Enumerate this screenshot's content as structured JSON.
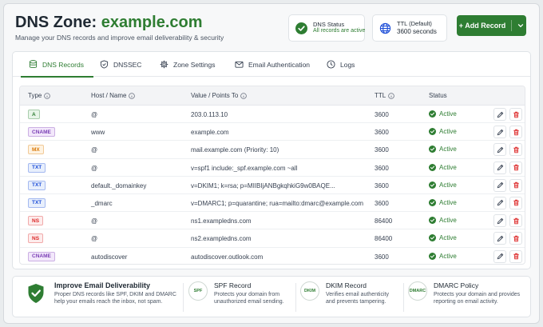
{
  "header": {
    "title_prefix": "DNS Zone: ",
    "title_domain": "example.com",
    "subtitle": "Manage your DNS records and improve email deliverability & security",
    "dns_status": {
      "title": "DNS Status",
      "value": "All records are active"
    },
    "ttl_default": {
      "title": "TTL (Default)",
      "value": "3600 seconds"
    },
    "add_record_label": "+ Add Record"
  },
  "tabs": [
    {
      "label": "DNS Records",
      "icon": "database-icon",
      "active": true
    },
    {
      "label": "DNSSEC",
      "icon": "shield-icon",
      "active": false
    },
    {
      "label": "Zone Settings",
      "icon": "gear-icon",
      "active": false
    },
    {
      "label": "Email Authentication",
      "icon": "envelope-icon",
      "active": false
    },
    {
      "label": "Logs",
      "icon": "clock-icon",
      "active": false
    }
  ],
  "table": {
    "columns": [
      "Type",
      "Host / Name",
      "Value / Points To",
      "TTL",
      "Status"
    ],
    "rows": [
      {
        "type": "A",
        "host": "@",
        "value": "203.0.113.10",
        "ttl": "3600",
        "status": "Active"
      },
      {
        "type": "CNAME",
        "host": "www",
        "value": "example.com",
        "ttl": "3600",
        "status": "Active"
      },
      {
        "type": "MX",
        "host": "@",
        "value": "mail.example.com (Priority: 10)",
        "ttl": "3600",
        "status": "Active"
      },
      {
        "type": "TXT",
        "host": "@",
        "value": "v=spf1 include:_spf.example.com ~all",
        "ttl": "3600",
        "status": "Active"
      },
      {
        "type": "TXT",
        "host": "default._domainkey",
        "value": "v=DKIM1; k=rsa; p=MIIBIjANBgkqhkiG9w0BAQE...",
        "ttl": "3600",
        "status": "Active"
      },
      {
        "type": "TXT",
        "host": "_dmarc",
        "value": "v=DMARC1; p=quarantine; rua=mailto:dmarc@example.com",
        "ttl": "3600",
        "status": "Active"
      },
      {
        "type": "NS",
        "host": "@",
        "value": "ns1.exampledns.com",
        "ttl": "86400",
        "status": "Active"
      },
      {
        "type": "NS",
        "host": "@",
        "value": "ns2.exampledns.com",
        "ttl": "86400",
        "status": "Active"
      },
      {
        "type": "CNAME",
        "host": "autodiscover",
        "value": "autodiscover.outlook.com",
        "ttl": "3600",
        "status": "Active"
      }
    ]
  },
  "bottom": {
    "main": {
      "title": "Improve Email Deliverability",
      "desc1": "Proper DNS records like SPF, DKIM and DMARC",
      "desc2": "help your emails reach the inbox, not spam."
    },
    "features": [
      {
        "icon_label": "SPF",
        "title": "SPF Record",
        "desc1": "Protects your domain from",
        "desc2": "unauthorized email sending."
      },
      {
        "icon_label": "DKIM",
        "title": "DKIM Record",
        "desc1": "Verifies email authenticity",
        "desc2": "and prevents tampering."
      },
      {
        "icon_label": "DMARC",
        "title": "DMARC Policy",
        "desc1": "Protects your domain and provides",
        "desc2": "reporting on email activity."
      }
    ]
  },
  "colors": {
    "accent": "#2e7d32",
    "badge_A": "#2e7d32",
    "badge_CNAME": "#7b3fb5",
    "badge_MX": "#d97706",
    "badge_TXT": "#1d4ed8",
    "badge_NS": "#dc2626"
  }
}
